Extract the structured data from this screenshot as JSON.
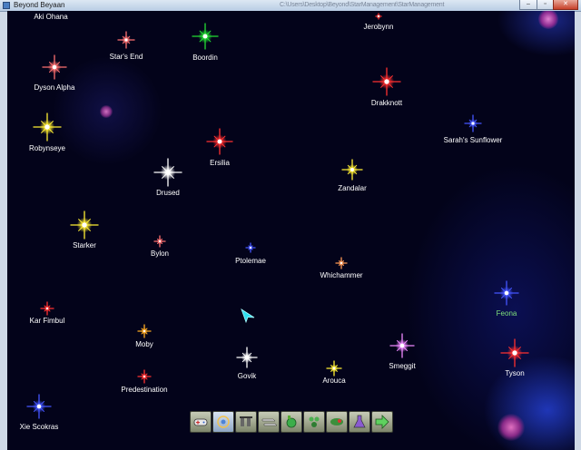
{
  "window": {
    "title": "Beyond Beyaan",
    "path": "C:\\Users\\Desktop\\Beyond\\StarManagement\\StarManagement",
    "min_glyph": "–",
    "max_glyph": "▫",
    "close_glyph": "✕"
  },
  "stars": [
    {
      "name": "Aki Ohana",
      "color": "#ffffff",
      "size": 0
    },
    {
      "name": "Jerobynn",
      "color": "#ff3030",
      "size": 3
    },
    {
      "name": "Star's End",
      "color": "#ff7070",
      "size": 9
    },
    {
      "name": "Boordin",
      "color": "#22dd33",
      "size": 14
    },
    {
      "name": "Dyson Alpha",
      "color": "#ff7070",
      "size": 13
    },
    {
      "name": "Drakknott",
      "color": "#ff3030",
      "size": 15
    },
    {
      "name": "Robynseye",
      "color": "#ffee33",
      "size": 15
    },
    {
      "name": "Sarah's Sunflower",
      "color": "#4455ff",
      "size": 9
    },
    {
      "name": "Ersilia",
      "color": "#ff3030",
      "size": 14
    },
    {
      "name": "Drused",
      "color": "#ffffff",
      "size": 15
    },
    {
      "name": "Zandalar",
      "color": "#ffee33",
      "size": 11
    },
    {
      "name": "Starker",
      "color": "#ffee33",
      "size": 15
    },
    {
      "name": "Bylon",
      "color": "#ff7070",
      "size": 6
    },
    {
      "name": "Ptolemae",
      "color": "#4455ff",
      "size": 5
    },
    {
      "name": "Whichammer",
      "color": "#ff9955",
      "size": 6
    },
    {
      "name": "Feona",
      "color": "#4455ff",
      "size": 13
    },
    {
      "name": "Kar Fimbul",
      "color": "#ff3030",
      "size": 7
    },
    {
      "name": "Moby",
      "color": "#ffaa22",
      "size": 7
    },
    {
      "name": "Smeggit",
      "color": "#ee88ff",
      "size": 13
    },
    {
      "name": "Tyson",
      "color": "#ff3030",
      "size": 15
    },
    {
      "name": "Govik",
      "color": "#ffffff",
      "size": 11
    },
    {
      "name": "Arouca",
      "color": "#ffee33",
      "size": 8
    },
    {
      "name": "Predestination",
      "color": "#ff3030",
      "size": 7
    },
    {
      "name": "Xie Scokras",
      "color": "#4455ff",
      "size": 13
    }
  ],
  "selected_star": "Feona",
  "label_colors": {
    "default": "#ffffff",
    "selected": "#7fe07a"
  },
  "toolbar": {
    "buttons": [
      {
        "name": "game-menu",
        "icon": "gamepad-icon"
      },
      {
        "name": "galaxy",
        "icon": "galaxy-icon"
      },
      {
        "name": "design",
        "icon": "tools-icon"
      },
      {
        "name": "ships",
        "icon": "fleet-icon"
      },
      {
        "name": "planets",
        "icon": "planet-icon"
      },
      {
        "name": "empires",
        "icon": "empire-icon"
      },
      {
        "name": "diplomacy",
        "icon": "diplomacy-icon"
      },
      {
        "name": "research",
        "icon": "flask-icon"
      },
      {
        "name": "end-turn",
        "icon": "arrow-right-icon"
      }
    ]
  }
}
